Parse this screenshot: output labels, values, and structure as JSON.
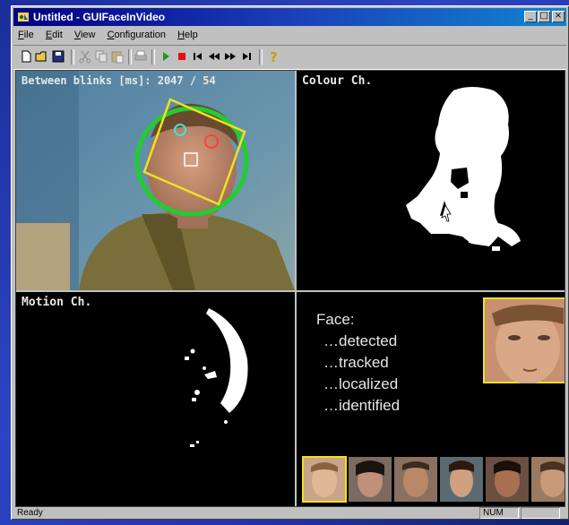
{
  "window": {
    "title": "Untitled - GUIFaceInVideo"
  },
  "menu": {
    "items": [
      {
        "accel": "F",
        "rest": "ile"
      },
      {
        "accel": "E",
        "rest": "dit"
      },
      {
        "accel": "V",
        "rest": "iew"
      },
      {
        "accel": "C",
        "rest": "onfiguration"
      },
      {
        "accel": "H",
        "rest": "elp"
      }
    ]
  },
  "toolbar": {
    "icons": [
      "new-file-icon",
      "open-folder-icon",
      "save-icon",
      "cut-icon",
      "copy-icon",
      "paste-icon",
      "print-icon",
      "play-icon",
      "stop-icon",
      "skip-start-icon",
      "rewind-icon",
      "fast-forward-icon",
      "skip-end-icon",
      "help-icon"
    ]
  },
  "panes": {
    "video": {
      "overlay": "Between blinks [ms]: 2047 / 54"
    },
    "colour": {
      "label": "Colour Ch."
    },
    "motion": {
      "label": "Motion Ch."
    },
    "face": {
      "heading": "Face:",
      "lines": [
        "…detected",
        "…tracked",
        "…localized",
        "…identified"
      ]
    }
  },
  "colors": {
    "tracking_box": "#f0e020",
    "face_ellipse": "#22cc33",
    "highlight": "#f0e020"
  },
  "status": {
    "text": "Ready",
    "num": "NUM"
  }
}
